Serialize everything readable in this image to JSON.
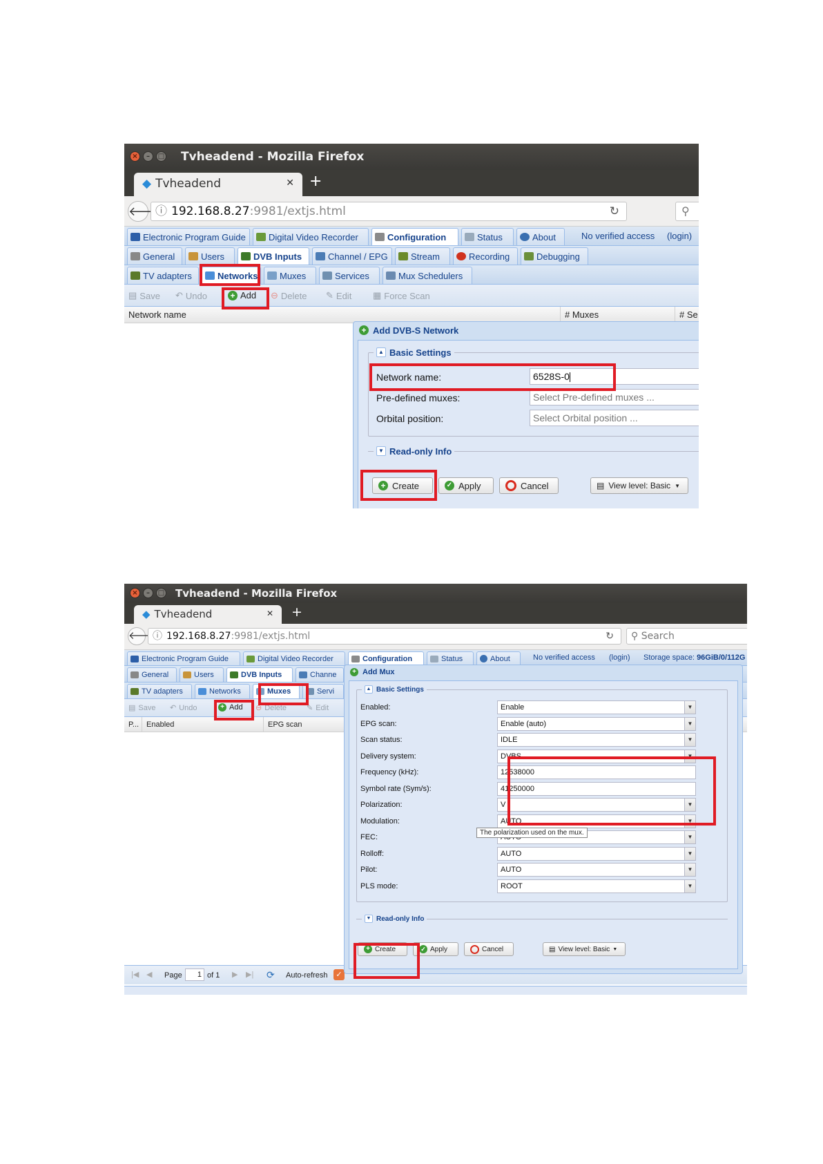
{
  "screenshot1": {
    "window_title": "Tvheadend - Mozilla Firefox",
    "tab_title": "Tvheadend",
    "url_host": "192.168.8.27",
    "url_rest": ":9981/extjs.html",
    "top_tabs": [
      "Electronic Program Guide",
      "Digital Video Recorder",
      "Configuration",
      "Status",
      "About"
    ],
    "access_text": "No verified access",
    "login_text": "(login)",
    "config_tabs": [
      "General",
      "Users",
      "DVB Inputs",
      "Channel / EPG",
      "Stream",
      "Recording",
      "Debugging"
    ],
    "dvb_tabs": [
      "TV adapters",
      "Networks",
      "Muxes",
      "Services",
      "Mux Schedulers"
    ],
    "toolbar": {
      "save": "Save",
      "undo": "Undo",
      "add": "Add",
      "delete": "Delete",
      "edit": "Edit",
      "force_scan": "Force Scan"
    },
    "columns": [
      "Network name",
      "# Muxes",
      "# Se"
    ],
    "dialog": {
      "title": "Add DVB-S Network",
      "basic_settings": "Basic Settings",
      "network_name_label": "Network name:",
      "network_name_value": "6528S-0",
      "predefined_label": "Pre-defined muxes:",
      "predefined_placeholder": "Select Pre-defined muxes ...",
      "orbital_label": "Orbital position:",
      "orbital_placeholder": "Select Orbital position ...",
      "readonly_info": "Read-only Info",
      "create": "Create",
      "apply": "Apply",
      "cancel": "Cancel",
      "view_level": "View level: Basic"
    }
  },
  "screenshot2": {
    "window_title": "Tvheadend - Mozilla Firefox",
    "tab_title": "Tvheadend",
    "url_host": "192.168.8.27",
    "url_rest": ":9981/extjs.html",
    "search_placeholder": "Search",
    "top_tabs": [
      "Electronic Program Guide",
      "Digital Video Recorder",
      "Configuration",
      "Status",
      "About"
    ],
    "access_text": "No verified access",
    "login_text": "(login)",
    "storage_label": "Storage space:",
    "storage_value": "96GiB/0/112G",
    "config_tabs": [
      "General",
      "Users",
      "DVB Inputs",
      "Channe"
    ],
    "dvb_tabs": [
      "TV adapters",
      "Networks",
      "Muxes",
      "Servi"
    ],
    "toolbar": {
      "save": "Save",
      "undo": "Undo",
      "add": "Add",
      "delete": "Delete",
      "edit": "Edit"
    },
    "columns": [
      "P...",
      "Enabled",
      "EPG scan"
    ],
    "pager": {
      "page_label": "Page",
      "page_value": "1",
      "of_label": "of 1",
      "auto_refresh": "Auto-refresh"
    },
    "dialog": {
      "title": "Add Mux",
      "basic_settings": "Basic Settings",
      "fields": [
        {
          "label": "Enabled:",
          "value": "Enable",
          "combo": true
        },
        {
          "label": "EPG scan:",
          "value": "Enable (auto)",
          "combo": true
        },
        {
          "label": "Scan status:",
          "value": "IDLE",
          "combo": true
        },
        {
          "label": "Delivery system:",
          "value": "DVBS",
          "combo": true
        },
        {
          "label": "Frequency (kHz):",
          "value": "12538000",
          "combo": false
        },
        {
          "label": "Symbol rate (Sym/s):",
          "value": "41250000",
          "combo": false
        },
        {
          "label": "Polarization:",
          "value": "V",
          "combo": true
        },
        {
          "label": "Modulation:",
          "value": "AUTO",
          "combo": true
        },
        {
          "label": "FEC:",
          "value": "AUTO",
          "combo": true
        },
        {
          "label": "Rolloff:",
          "value": "AUTO",
          "combo": true
        },
        {
          "label": "Pilot:",
          "value": "AUTO",
          "combo": true
        },
        {
          "label": "PLS mode:",
          "value": "ROOT",
          "combo": true
        }
      ],
      "tooltip": "The polarization used on the mux.",
      "readonly_info": "Read-only Info",
      "create": "Create",
      "apply": "Apply",
      "cancel": "Cancel",
      "view_level": "View level: Basic"
    }
  },
  "colors": {
    "highlight": "#e01b24",
    "ext_blue": "#15428b"
  }
}
